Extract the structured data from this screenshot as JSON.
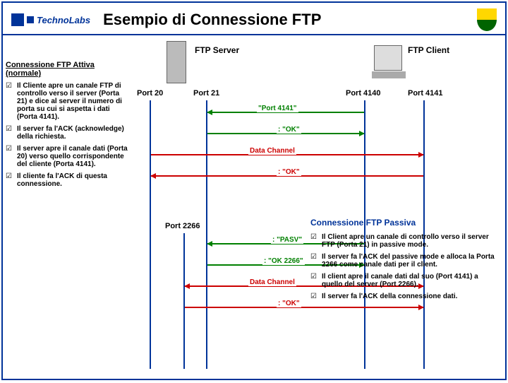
{
  "header": {
    "logo": "TechnoLabs",
    "title": "Esempio di Connessione FTP"
  },
  "roles": {
    "server": "FTP Server",
    "client": "FTP Client"
  },
  "ports": {
    "p20": "Port 20",
    "p21": "Port 21",
    "p4140": "Port 4140",
    "p4141": "Port 4141",
    "p2266": "Port 2266"
  },
  "msgs": {
    "m1": "\"Port 4141\"",
    "m2": ": \"OK\"",
    "m3": "Data Channel",
    "m4": ": \"OK\"",
    "m5": ": \"PASV\"",
    "m6": ": \"OK 2266\"",
    "m7": "Data Channel",
    "m8": ": \"OK\""
  },
  "active": {
    "title": "Connessione  FTP Attiva (normale)",
    "items": [
      "Il Cliente apre un canale FTP di controllo verso il server (Porta 21) e dice al server il numero di porta su cui si aspetta i dati (Porta 4141).",
      "Il server fa l'ACK (acknowledge) della richiesta.",
      "Il server apre il canale dati (Porta 20) verso quello corrispondente del  cliente (Porta 4141).",
      "Il cliente fa l'ACK di questa connessione."
    ]
  },
  "passive": {
    "title": "Connessione FTP Passiva",
    "items": [
      "Il Client apre un canale di controllo verso il server FTP  (Porta 21) in passive mode.",
      "Il server fa l'ACK del passive mode e alloca la Porta 2266 come canale dati per il client.",
      "Il client apre  il canale dati dal suo (Port 4141) a quello del server (Port 2266).",
      "Il server fa l'ACK della connessione dati."
    ]
  },
  "check": "☑"
}
